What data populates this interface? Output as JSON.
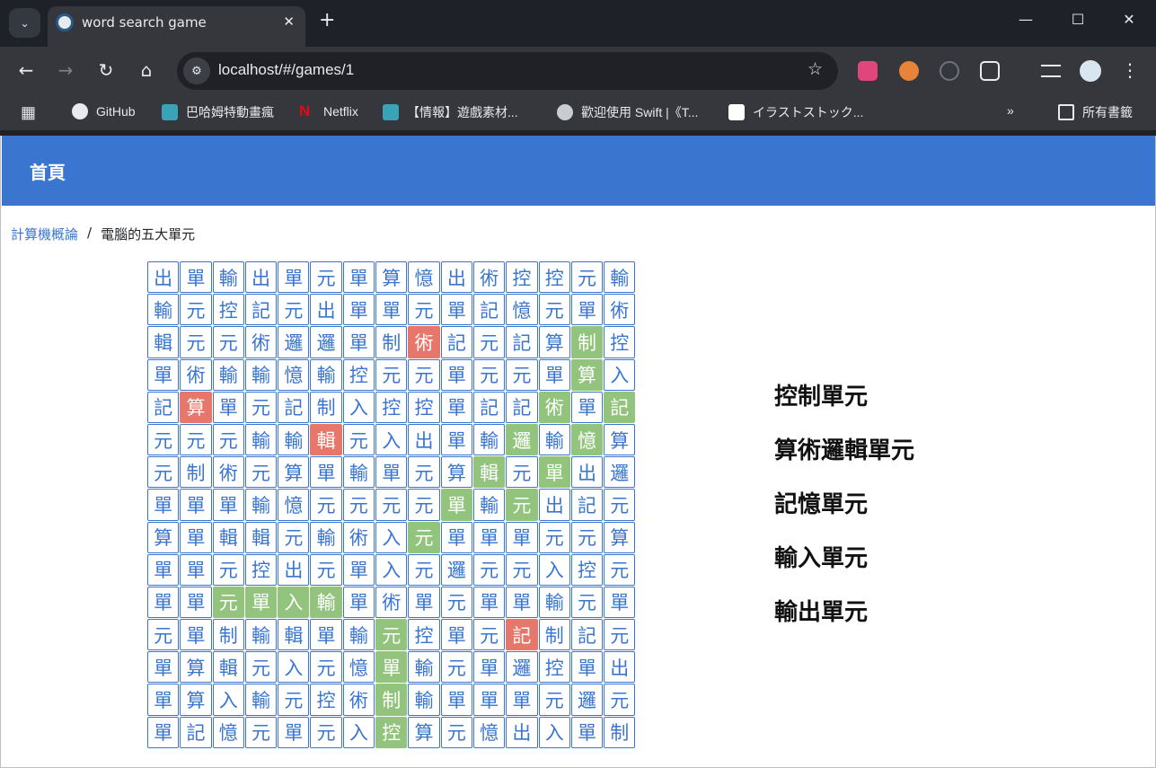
{
  "browser": {
    "tab_title": "word search game",
    "url": "localhost/#/games/1",
    "bookmarks": [
      "GitHub",
      "巴哈姆特動畫瘋",
      "Netflix",
      "【情報】遊戲素材...",
      "歡迎使用 Swift |《T...",
      "イラストストック...",
      "所有書籤"
    ]
  },
  "nav": {
    "home": "首頁"
  },
  "breadcrumb": {
    "parent": "計算機概論",
    "separator": "/",
    "current": "電腦的五大單元"
  },
  "grid": {
    "rows": [
      [
        "出",
        "單",
        "輸",
        "出",
        "單",
        "元",
        "單",
        "算",
        "憶",
        "出",
        "術",
        "控",
        "控",
        "元",
        "輸"
      ],
      [
        "輸",
        "元",
        "控",
        "記",
        "元",
        "出",
        "單",
        "單",
        "元",
        "單",
        "記",
        "憶",
        "元",
        "單",
        "術"
      ],
      [
        "輯",
        "元",
        "元",
        "術",
        "邏",
        "邏",
        "單",
        "制",
        "術",
        "記",
        "元",
        "記",
        "算",
        "制",
        "控"
      ],
      [
        "單",
        "術",
        "輸",
        "輸",
        "憶",
        "輸",
        "控",
        "元",
        "元",
        "單",
        "元",
        "元",
        "單",
        "算",
        "入"
      ],
      [
        "記",
        "算",
        "單",
        "元",
        "記",
        "制",
        "入",
        "控",
        "控",
        "單",
        "記",
        "記",
        "術",
        "單",
        "記"
      ],
      [
        "元",
        "元",
        "元",
        "輸",
        "輸",
        "輯",
        "元",
        "入",
        "出",
        "單",
        "輸",
        "邏",
        "輸",
        "憶",
        "算"
      ],
      [
        "元",
        "制",
        "術",
        "元",
        "算",
        "單",
        "輸",
        "單",
        "元",
        "算",
        "輯",
        "元",
        "單",
        "出",
        "邏"
      ],
      [
        "單",
        "單",
        "單",
        "輸",
        "憶",
        "元",
        "元",
        "元",
        "元",
        "單",
        "輸",
        "元",
        "出",
        "記",
        "元"
      ],
      [
        "算",
        "單",
        "輯",
        "輯",
        "元",
        "輸",
        "術",
        "入",
        "元",
        "單",
        "單",
        "單",
        "元",
        "元",
        "算"
      ],
      [
        "單",
        "單",
        "元",
        "控",
        "出",
        "元",
        "單",
        "入",
        "元",
        "邏",
        "元",
        "元",
        "入",
        "控",
        "元"
      ],
      [
        "單",
        "單",
        "元",
        "單",
        "入",
        "輸",
        "單",
        "術",
        "單",
        "元",
        "單",
        "單",
        "輸",
        "元",
        "單"
      ],
      [
        "元",
        "單",
        "制",
        "輸",
        "輯",
        "單",
        "輸",
        "元",
        "控",
        "單",
        "元",
        "記",
        "制",
        "記",
        "元"
      ],
      [
        "單",
        "算",
        "輯",
        "元",
        "入",
        "元",
        "憶",
        "單",
        "輸",
        "元",
        "單",
        "邏",
        "控",
        "單",
        "出"
      ],
      [
        "單",
        "算",
        "入",
        "輸",
        "元",
        "控",
        "術",
        "制",
        "輸",
        "單",
        "單",
        "單",
        "元",
        "邏",
        "元"
      ],
      [
        "單",
        "記",
        "憶",
        "元",
        "單",
        "元",
        "入",
        "控",
        "算",
        "元",
        "憶",
        "出",
        "入",
        "單",
        "制"
      ]
    ],
    "found": [
      [
        2,
        13
      ],
      [
        3,
        13
      ],
      [
        4,
        12
      ],
      [
        4,
        14
      ],
      [
        5,
        11
      ],
      [
        5,
        13
      ],
      [
        6,
        10
      ],
      [
        6,
        12
      ],
      [
        7,
        9
      ],
      [
        7,
        11
      ],
      [
        8,
        8
      ],
      [
        10,
        2
      ],
      [
        10,
        3
      ],
      [
        10,
        4
      ],
      [
        10,
        5
      ],
      [
        11,
        7
      ],
      [
        12,
        7
      ],
      [
        13,
        7
      ],
      [
        14,
        7
      ]
    ],
    "wrong": [
      [
        2,
        8
      ],
      [
        4,
        1
      ],
      [
        5,
        5
      ],
      [
        11,
        11
      ]
    ],
    "colors": {
      "border": "#3a76cf",
      "found": "#93c47d",
      "wrong": "#e8776b"
    }
  },
  "words": [
    "控制單元",
    "算術邏輯單元",
    "記憶單元",
    "輸入單元",
    "輸出單元"
  ]
}
